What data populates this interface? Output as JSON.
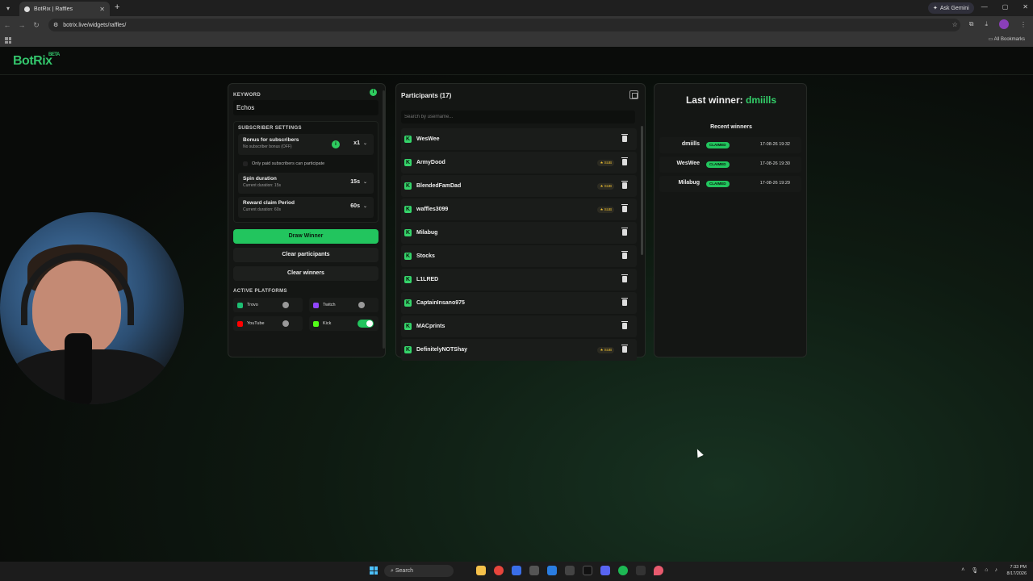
{
  "browser": {
    "tab_title": "BotRix | Raffles",
    "url": "botrix.live/widgets/raffles/",
    "gemini_label": "Ask Gemini",
    "all_bookmarks": "All Bookmarks"
  },
  "header": {
    "logo": "BotRix",
    "beta": "BETA"
  },
  "left_panel": {
    "keyword_label": "KEYWORD",
    "keyword_value": "Echos",
    "subscriber_settings_label": "SUBSCRIBER SETTINGS",
    "bonus": {
      "title": "Bonus for subscribers",
      "subtitle": "No subscriber bonus (OFF)",
      "value": "x1"
    },
    "paid_only_label": "Only paid subscribers can participate",
    "spin": {
      "title": "Spin duration",
      "subtitle": "Current duration: 15s",
      "value": "15s"
    },
    "reward": {
      "title": "Reward claim Period",
      "subtitle": "Current duration: 60s",
      "value": "60s"
    },
    "draw_button": "Draw Winner",
    "clear_participants_button": "Clear participants",
    "clear_winners_button": "Clear winners",
    "active_platforms_label": "ACTIVE PLATFORMS",
    "platforms": [
      {
        "name": "Trovo",
        "color": "#1dbf73",
        "enabled": false
      },
      {
        "name": "Twitch",
        "color": "#9146ff",
        "enabled": false
      },
      {
        "name": "YouTube",
        "color": "#ff0000",
        "enabled": false
      },
      {
        "name": "Kick",
        "color": "#53fc18",
        "enabled": true
      }
    ]
  },
  "participants": {
    "title": "Participants (17)",
    "search_placeholder": "Search by username...",
    "sub_badge_label": "SUB",
    "list": [
      {
        "name": "WesWee",
        "sub": false
      },
      {
        "name": "ArmyDood",
        "sub": true
      },
      {
        "name": "BlendedFamDad",
        "sub": true
      },
      {
        "name": "waffles3099",
        "sub": true
      },
      {
        "name": "Milabug",
        "sub": false
      },
      {
        "name": "Stocks",
        "sub": false
      },
      {
        "name": "L1LRED",
        "sub": false
      },
      {
        "name": "CaptainInsano975",
        "sub": false
      },
      {
        "name": "MACprints",
        "sub": false
      },
      {
        "name": "DefinitelyNOTShay",
        "sub": true
      }
    ]
  },
  "winners": {
    "last_winner_label": "Last winner:",
    "last_winner_name": "dmiills",
    "recent_label": "Recent winners",
    "claimed_label": "CLAIMED",
    "list": [
      {
        "name": "dmiills",
        "time": "17-08-26 19:32"
      },
      {
        "name": "WesWee",
        "time": "17-08-26 19:30"
      },
      {
        "name": "Milabug",
        "time": "17-08-26 19:29"
      }
    ]
  },
  "taskbar": {
    "search_label": "Search",
    "time": "7:33 PM",
    "date": "8/17/2026"
  },
  "colors": {
    "accent": "#22c55e",
    "sub_gold": "#f1c232"
  }
}
